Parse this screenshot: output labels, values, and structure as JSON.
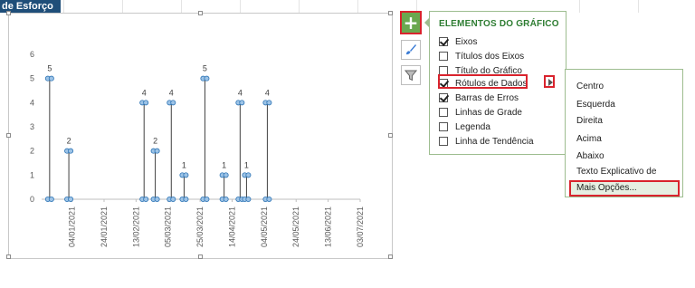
{
  "sheet": {
    "title_fragment": "de Esforço"
  },
  "chart_buttons": {
    "elements_icon": "plus-icon",
    "styles_icon": "brush-icon",
    "filters_icon": "filter-icon"
  },
  "panel": {
    "title": "ELEMENTOS DO GRÁFICO",
    "items": [
      {
        "label": "Eixos",
        "checked": true
      },
      {
        "label": "Títulos dos Eixos",
        "checked": false
      },
      {
        "label": "Título do Gráfico",
        "checked": false
      },
      {
        "label": "Rótulos de Dados",
        "checked": true
      },
      {
        "label": "Barras de Erros",
        "checked": true
      },
      {
        "label": "Linhas de Grade",
        "checked": false
      },
      {
        "label": "Legenda",
        "checked": false
      },
      {
        "label": "Linha de Tendência",
        "checked": false
      }
    ]
  },
  "submenu": {
    "items": [
      "Centro",
      "Esquerda",
      "Direita",
      "Acima",
      "Abaixo",
      "Texto Explicativo de Dados",
      "Mais Opções..."
    ]
  },
  "colors": {
    "accent_green": "#6aa84f",
    "highlight_red": "#d9232d",
    "marker_blue": "#5b9bd5"
  },
  "chart_data": {
    "type": "scatter",
    "title": "",
    "xlabel": "",
    "ylabel": "",
    "ylim": [
      0,
      6
    ],
    "y_ticks": [
      "0",
      "1",
      "2",
      "3",
      "4",
      "5",
      "6"
    ],
    "x_range": [
      "2020-12-16",
      "2021-07-03"
    ],
    "x_ticks": [
      "04/01/2021",
      "24/01/2021",
      "13/02/2021",
      "05/03/2021",
      "25/03/2021",
      "14/04/2021",
      "04/05/2021",
      "24/05/2021",
      "13/06/2021",
      "03/07/2021"
    ],
    "error_bars": "minus 100%",
    "points": [
      {
        "x": "2020-12-21",
        "y": 5,
        "label": "5"
      },
      {
        "x": "2021-01-02",
        "y": 2,
        "label": "2"
      },
      {
        "x": "2021-02-18",
        "y": 4,
        "label": "4"
      },
      {
        "x": "2021-02-25",
        "y": 2,
        "label": "2"
      },
      {
        "x": "2021-03-07",
        "y": 4,
        "label": "4"
      },
      {
        "x": "2021-03-15",
        "y": 1,
        "label": "1"
      },
      {
        "x": "2021-03-28",
        "y": 5,
        "label": "5"
      },
      {
        "x": "2021-04-09",
        "y": 1,
        "label": "1"
      },
      {
        "x": "2021-04-19",
        "y": 4,
        "label": "4"
      },
      {
        "x": "2021-04-23",
        "y": 1,
        "label": "1"
      },
      {
        "x": "2021-05-06",
        "y": 4,
        "label": "4"
      }
    ]
  }
}
